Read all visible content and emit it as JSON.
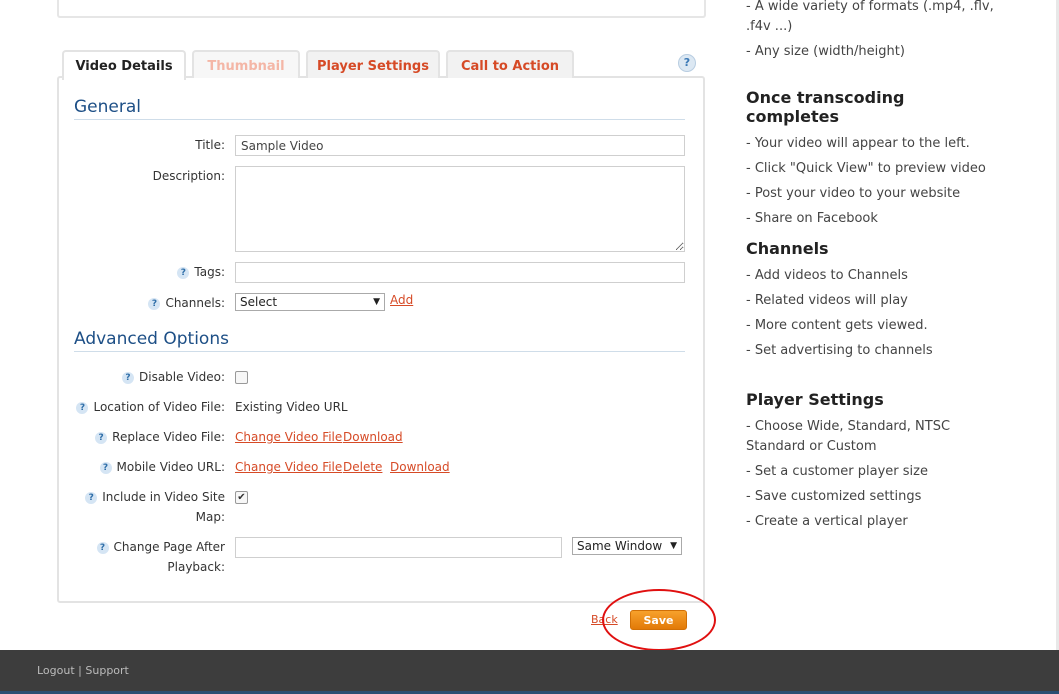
{
  "tabs": [
    {
      "label": "Video Details"
    },
    {
      "label": "Thumbnail"
    },
    {
      "label": "Player Settings"
    },
    {
      "label": "Call to Action"
    }
  ],
  "help_symbol": "?",
  "general": {
    "heading": "General",
    "title_label": "Title:",
    "title_value": "Sample Video",
    "description_label": "Description:",
    "tags_label": "Tags:",
    "channels_label": "Channels:",
    "channels_selected": "Select",
    "add_link": "Add"
  },
  "advanced": {
    "heading": "Advanced Options",
    "disable_label": "Disable Video:",
    "location_label": "Location of Video File:",
    "location_value": "Existing Video URL",
    "replace_label": "Replace Video File:",
    "replace_change": "Change Video File",
    "replace_download": "Download",
    "mobile_label": "Mobile Video URL:",
    "mobile_change": "Change Video File",
    "mobile_delete": "Delete",
    "mobile_download": "Download",
    "sitemap_label_1": "Include in Video Site",
    "sitemap_label_2": "Map:",
    "change_page_label_1": "Change Page After",
    "change_page_label_2": "Playback:",
    "window_selected": "Same Window"
  },
  "actions": {
    "back": "Back",
    "save": "Save"
  },
  "sidebar": {
    "top_items": [
      "- A wide variety of formats (.mp4, .flv, .f4v ...)",
      "- Any size (width/height)"
    ],
    "sections": [
      {
        "title": "Once transcoding completes",
        "items": [
          "- Your video will appear to the left.",
          "- Click \"Quick View\" to preview video",
          "- Post your video to your website",
          "- Share on Facebook"
        ]
      },
      {
        "title": "Channels",
        "items": [
          "- Add videos to Channels",
          "- Related videos will play",
          "- More content gets viewed.",
          "- Set advertising to channels"
        ]
      },
      {
        "title": "Player Settings",
        "items": [
          "- Choose Wide, Standard, NTSC Standard or Custom",
          "- Set a customer player size",
          "- Save customized settings",
          "- Create a vertical player"
        ]
      }
    ]
  },
  "footer": {
    "logout": "Logout",
    "separator": "|",
    "support": "Support"
  },
  "colors": {
    "accent": "#d64a26",
    "heading": "#1d4f86",
    "save": "#f08c16",
    "highlight_circle": "#e01010"
  }
}
